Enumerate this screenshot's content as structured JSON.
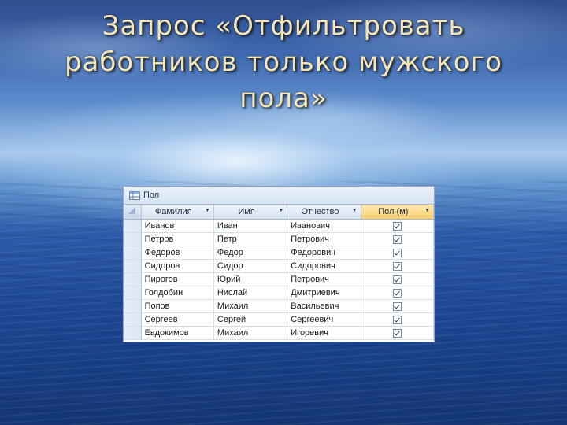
{
  "slide": {
    "title": "Запрос «Отфильтровать работников только мужского пола»"
  },
  "window": {
    "tab_label": "Пол",
    "tab_icon": "table-icon"
  },
  "table": {
    "columns": [
      "Фамилия",
      "Имя",
      "Отчество",
      "Пол (м)"
    ],
    "highlight_column": "Пол (м)",
    "rows": [
      {
        "last": "Иванов",
        "first": "Иван",
        "patronymic": "Иванович",
        "male": true
      },
      {
        "last": "Петров",
        "first": "Петр",
        "patronymic": "Петрович",
        "male": true
      },
      {
        "last": "Федоров",
        "first": "Федор",
        "patronymic": "Федорович",
        "male": true
      },
      {
        "last": "Сидоров",
        "first": "Сидор",
        "patronymic": "Сидорович",
        "male": true
      },
      {
        "last": "Пирогов",
        "first": "Юрий",
        "patronymic": "Петрович",
        "male": true
      },
      {
        "last": "Голдобин",
        "first": "Нислай",
        "patronymic": "Дмитриевич",
        "male": true
      },
      {
        "last": "Попов",
        "first": "Михаил",
        "patronymic": "Васильевич",
        "male": true
      },
      {
        "last": "Сергеев",
        "first": "Сергей",
        "patronymic": "Сергеевич",
        "male": true
      },
      {
        "last": "Евдокимов",
        "first": "Михаил",
        "patronymic": "Игоревич",
        "male": true
      }
    ]
  }
}
